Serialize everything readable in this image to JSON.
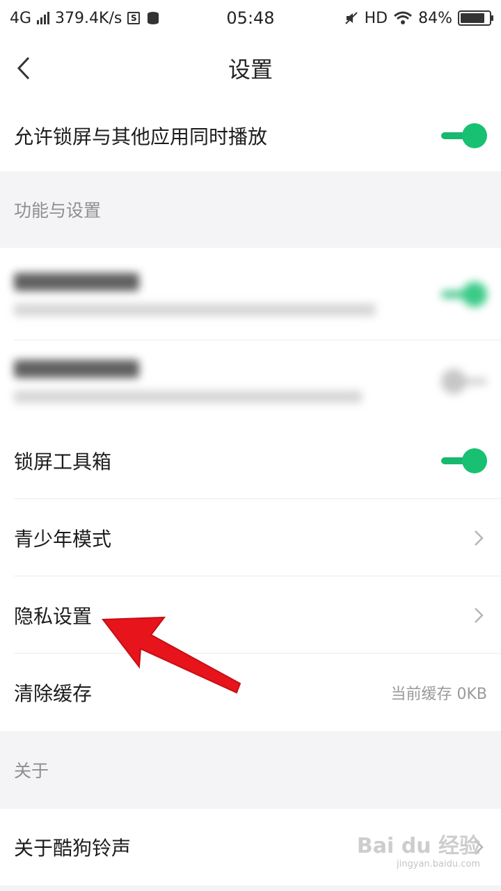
{
  "status_bar": {
    "network": "4G",
    "speed": "379.4K/s",
    "time": "05:48",
    "hd": "HD",
    "battery": "84%",
    "battery_level": 0.84,
    "sim_icon_letter": "S"
  },
  "nav": {
    "title": "设置"
  },
  "rows": {
    "lock_play": {
      "label": "允许锁屏与其他应用同时播放",
      "toggle_on": true
    },
    "section_features": "功能与设置",
    "toolbox": {
      "label": "锁屏工具箱",
      "toggle_on": true
    },
    "teen": {
      "label": "青少年模式"
    },
    "privacy": {
      "label": "隐私设置"
    },
    "cache": {
      "label": "清除缓存",
      "value": "当前缓存 0KB"
    },
    "section_about": "关于",
    "about": {
      "label": "关于酷狗铃声"
    }
  },
  "watermark": {
    "brand": "Bai du 经验",
    "url": "jingyan.baidu.com"
  },
  "colors": {
    "accent": "#18c172",
    "arrow": "#e8141b"
  }
}
